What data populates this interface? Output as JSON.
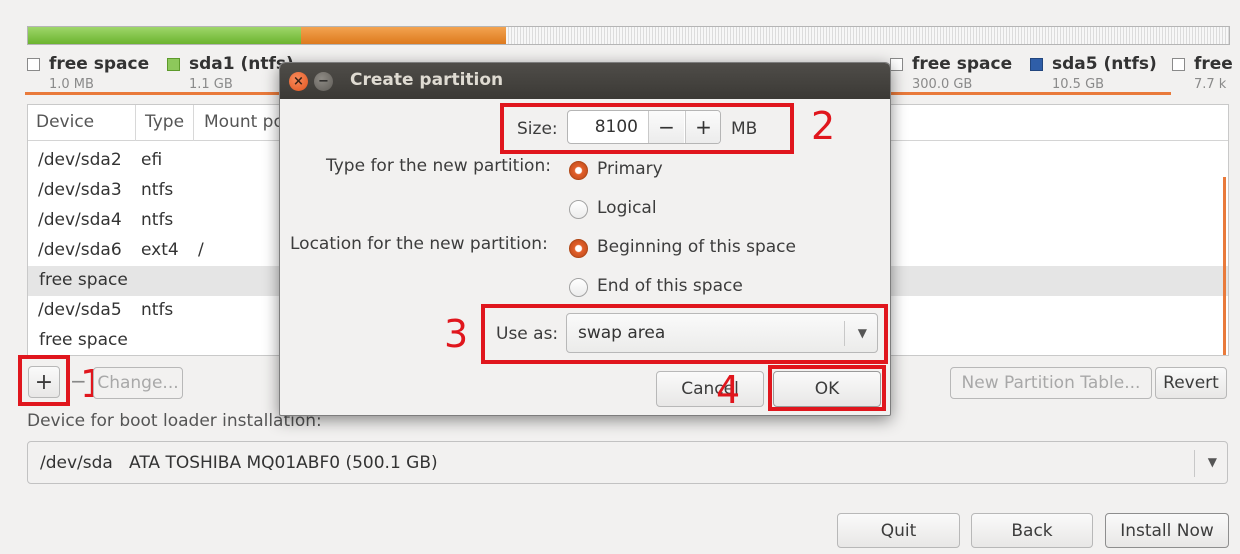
{
  "partition_bar": {
    "colors": {
      "ntfs": "#6bb42f",
      "fat32": "#dd7a1e",
      "free": "#f7f7f7",
      "sda5": "#2f5ea8"
    }
  },
  "legend": [
    {
      "name": "free space",
      "size": "1.0 MB",
      "color": "#ffffff"
    },
    {
      "name": "sda1 (ntfs)",
      "size": "1.1 GB",
      "color": "#8dc85b"
    },
    {
      "name": "free space",
      "size": "300.0 GB",
      "color": "#ffffff"
    },
    {
      "name": "sda5 (ntfs)",
      "size": "10.5 GB",
      "color": "#2f5ea8"
    },
    {
      "name": "free",
      "size": "7.7 k",
      "color": "#ffffff"
    }
  ],
  "table": {
    "headers": [
      "Device",
      "Type",
      "Mount po"
    ],
    "rows": [
      {
        "device": "/dev/sda2",
        "type": "efi",
        "mount": ""
      },
      {
        "device": "/dev/sda3",
        "type": "ntfs",
        "mount": ""
      },
      {
        "device": "/dev/sda4",
        "type": "ntfs",
        "mount": ""
      },
      {
        "device": "/dev/sda6",
        "type": "ext4",
        "mount": "/"
      },
      {
        "device": "free space",
        "type": "",
        "mount": ""
      },
      {
        "device": "/dev/sda5",
        "type": "ntfs",
        "mount": ""
      },
      {
        "device": "free space",
        "type": "",
        "mount": ""
      }
    ]
  },
  "toolbar": {
    "add_label": "+",
    "remove_label": "−",
    "change_label": "Change...",
    "new_table_label": "New Partition Table...",
    "revert_label": "Revert"
  },
  "bootloader": {
    "label": "Device for boot loader installation:",
    "value": "/dev/sda   ATA TOSHIBA MQ01ABF0 (500.1 GB)"
  },
  "footer": {
    "quit_label": "Quit",
    "back_label": "Back",
    "install_label": "Install Now"
  },
  "dialog": {
    "title": "Create partition",
    "size_label": "Size:",
    "size_value": "8100",
    "size_unit": "MB",
    "minus_label": "−",
    "plus_label": "+",
    "type_label": "Type for the new partition:",
    "type_options": [
      {
        "label": "Primary",
        "checked": true
      },
      {
        "label": "Logical",
        "checked": false
      }
    ],
    "location_label": "Location for the new partition:",
    "location_options": [
      {
        "label": "Beginning of this space",
        "checked": true
      },
      {
        "label": "End of this space",
        "checked": false
      }
    ],
    "use_as_label": "Use as:",
    "use_as_value": "swap area",
    "cancel_label": "Cancel",
    "ok_label": "OK"
  },
  "annotations": {
    "step1": "1",
    "step2": "2",
    "step3": "3",
    "step4": "4",
    "color": "#e0161d"
  }
}
